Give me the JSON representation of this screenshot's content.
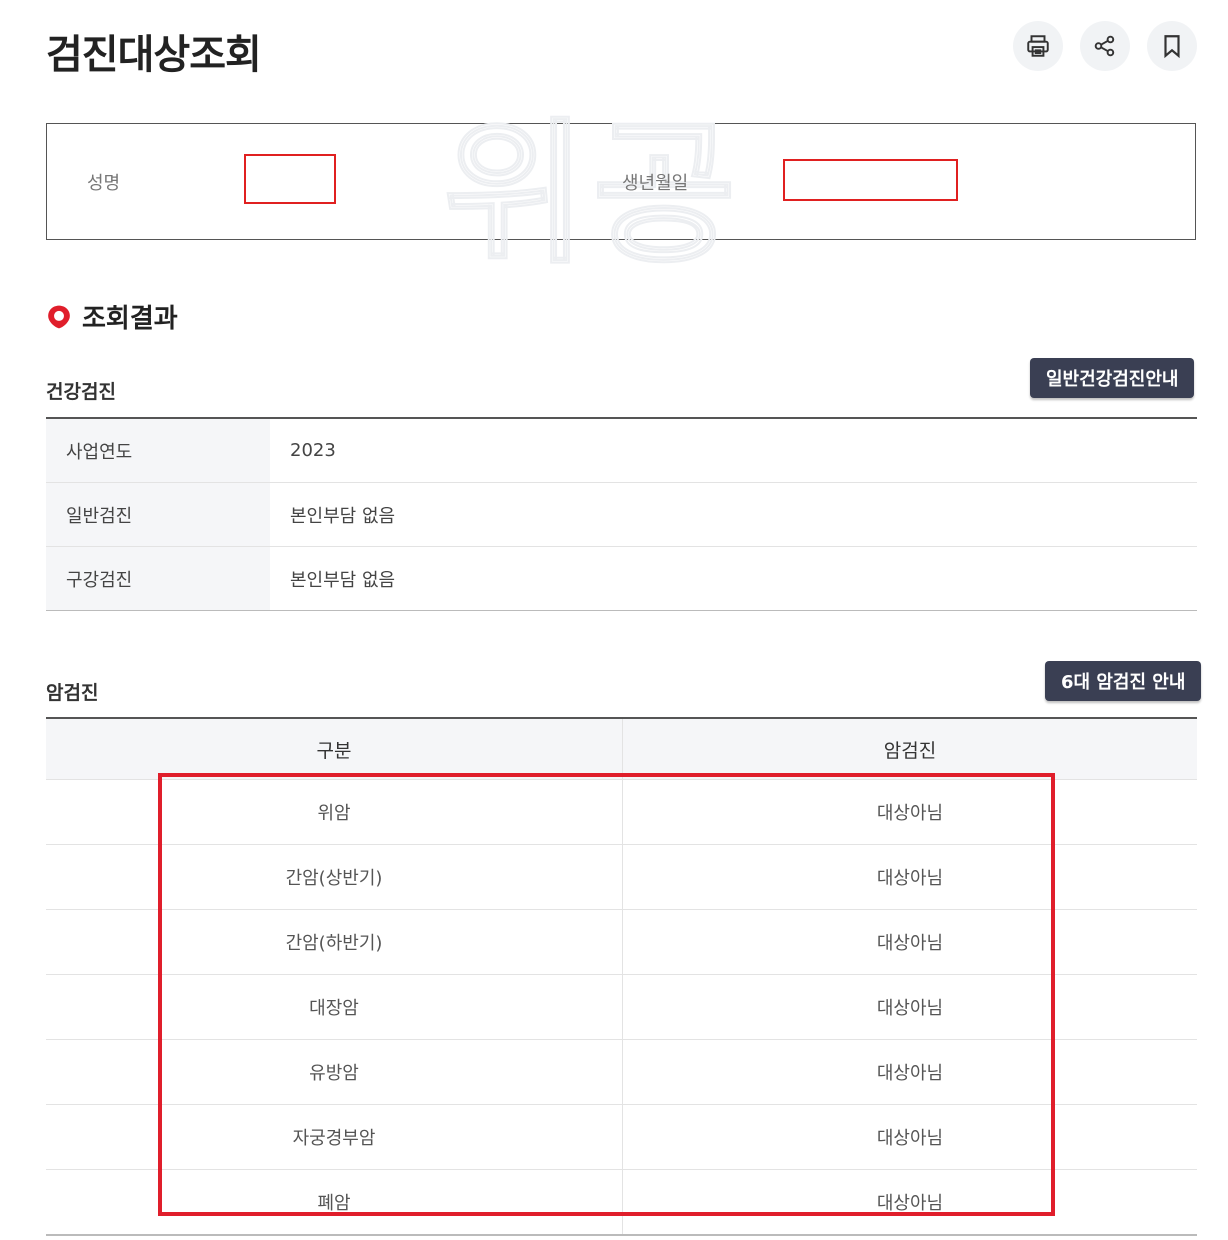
{
  "page": {
    "title": "검진대상조회"
  },
  "toolbar": {
    "print_icon": "print-icon",
    "share_icon": "share-icon",
    "bookmark_icon": "bookmark-icon"
  },
  "query": {
    "watermark": "위공",
    "name_label": "성명",
    "name_value": "",
    "birth_label": "생년월일",
    "birth_value": "",
    "mask_color": "#e02020"
  },
  "result": {
    "title": "조회결과",
    "icon": "location-pin-icon",
    "accent_color": "#e01e2b"
  },
  "health": {
    "title": "건강검진",
    "guide_button": "일반건강검진안내",
    "rows": [
      {
        "label": "사업연도",
        "value": "2023"
      },
      {
        "label": "일반검진",
        "value": "본인부담 없음"
      },
      {
        "label": "구강검진",
        "value": "본인부담 없음"
      }
    ]
  },
  "cancer": {
    "title": "암검진",
    "guide_button": "6대 암검진 안내",
    "columns": [
      "구분",
      "암검진"
    ],
    "rows": [
      {
        "type": "위암",
        "status": "대상아님"
      },
      {
        "type": "간암(상반기)",
        "status": "대상아님"
      },
      {
        "type": "간암(하반기)",
        "status": "대상아님"
      },
      {
        "type": "대장암",
        "status": "대상아님"
      },
      {
        "type": "유방암",
        "status": "대상아님"
      },
      {
        "type": "자궁경부암",
        "status": "대상아님"
      },
      {
        "type": "폐암",
        "status": "대상아님"
      }
    ],
    "highlight_color": "#e01e2b"
  },
  "colors": {
    "button_bg": "#3a3f53",
    "header_bg": "#f5f6f8"
  }
}
